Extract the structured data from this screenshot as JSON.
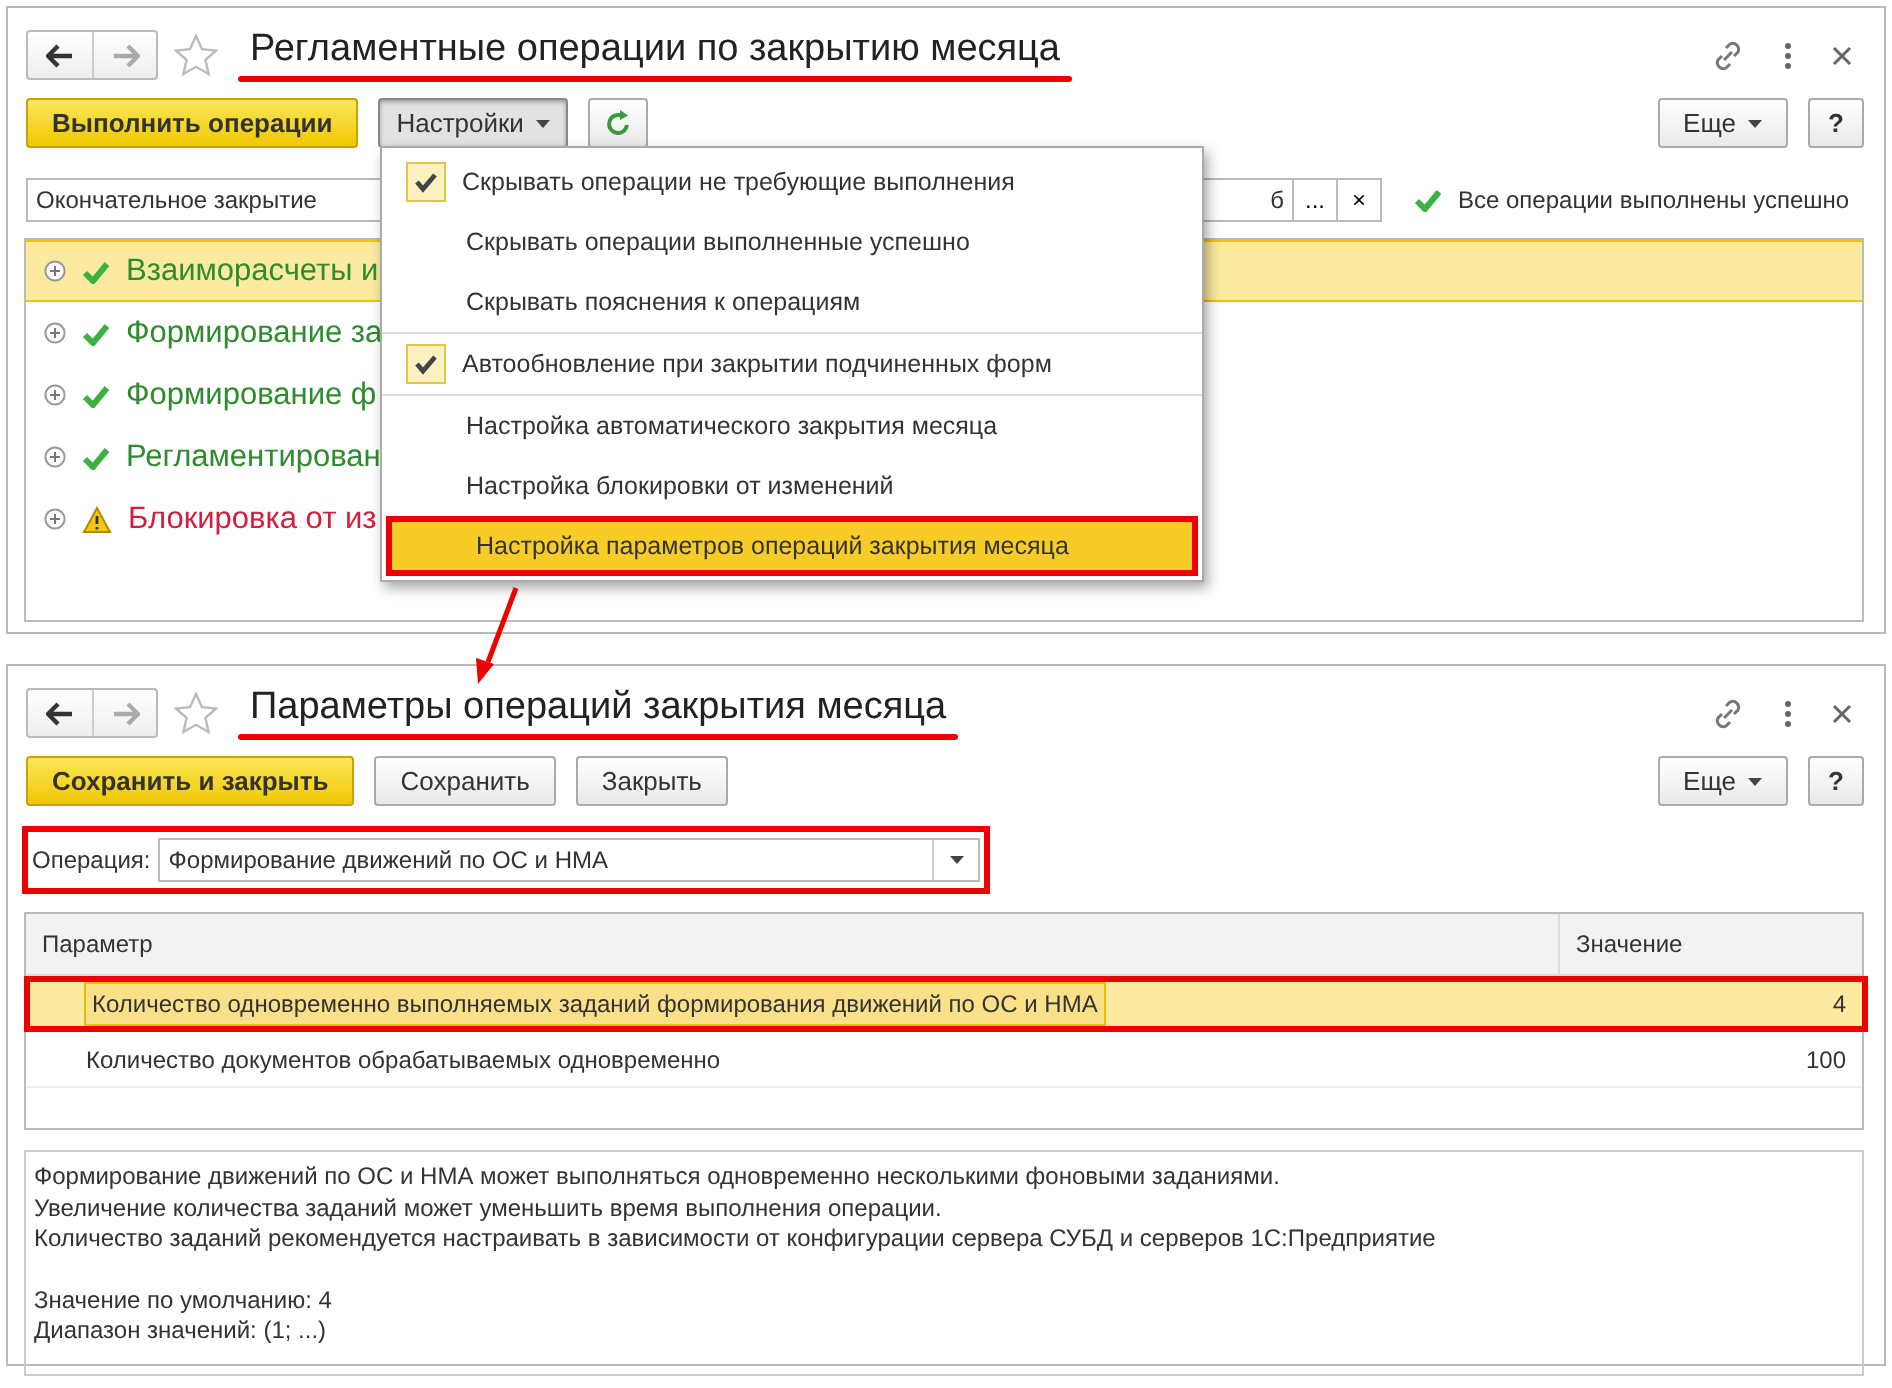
{
  "main_window": {
    "title": "Регламентные операции по закрытию месяца",
    "title_underlined": true,
    "toolbar": {
      "run_button": "Выполнить операции",
      "settings_button": "Настройки",
      "settings_open": true,
      "more_button": "Еще",
      "help_button": "?"
    },
    "filter": {
      "closing_type": "Окончательное закрытие",
      "field_2": "б",
      "select_button": "...",
      "clear_button": "×",
      "status": "Все операции выполнены успешно"
    },
    "operations": [
      {
        "label": "Взаиморасчеты и",
        "kind": "done",
        "selected": true
      },
      {
        "label": "Формирование за",
        "kind": "done",
        "selected": false
      },
      {
        "label": "Формирование ф",
        "kind": "done",
        "selected": false
      },
      {
        "label": "Регламентирован",
        "kind": "done",
        "selected": false
      },
      {
        "label": "Блокировка от из",
        "kind": "warning",
        "selected": false
      }
    ],
    "settings_menu": {
      "groups": [
        [
          {
            "label": "Скрывать операции не требующие выполнения",
            "checked": true,
            "selected": false,
            "highlighted": false
          },
          {
            "label": "Скрывать операции выполненные успешно",
            "checked": false,
            "selected": false,
            "highlighted": false
          },
          {
            "label": "Скрывать пояснения к операциям",
            "checked": false,
            "selected": false,
            "highlighted": false
          }
        ],
        [
          {
            "label": "Автообновление при закрытии подчиненных форм",
            "checked": true,
            "selected": false,
            "highlighted": false
          }
        ],
        [
          {
            "label": "Настройка автоматического закрытия месяца",
            "checked": false,
            "selected": false,
            "highlighted": false
          },
          {
            "label": "Настройка блокировки от изменений",
            "checked": false,
            "selected": false,
            "highlighted": false
          },
          {
            "label": "Настройка параметров операций закрытия месяца",
            "checked": false,
            "selected": true,
            "highlighted": true
          }
        ]
      ]
    }
  },
  "annotation_arrow": true,
  "params_window": {
    "title": "Параметры операций закрытия месяца",
    "title_underlined": true,
    "toolbar": {
      "save_close_button": "Сохранить и закрыть",
      "save_button": "Сохранить",
      "close_button": "Закрыть",
      "more_button": "Еще",
      "help_button": "?"
    },
    "operation": {
      "label": "Операция:",
      "value": "Формирование движений по ОС и НМА",
      "highlighted": true
    },
    "table": {
      "columns": [
        "Параметр",
        "Значение"
      ],
      "rows": [
        {
          "parameter": "Количество одновременно выполняемых заданий формирования движений по ОС и НМА",
          "value": "4",
          "selected": true,
          "highlighted": true
        },
        {
          "parameter": "Количество документов обрабатываемых одновременно",
          "value": "100",
          "selected": false,
          "highlighted": false
        }
      ]
    },
    "description": {
      "paragraphs": [
        {
          "lines": [
            "Формирование движений по ОС и НМА может выполняться одновременно несколькими фоновыми заданиями.",
            "Увеличение количества заданий может уменьшить время выполнения операции.",
            "Количество заданий рекомендуется настраивать в зависимости от конфигурации сервера СУБД и серверов 1С:Предприятие"
          ]
        },
        {
          "lines": [
            "Значение по умолчанию: 4",
            "Диапазон значений: (1; ...)"
          ]
        }
      ]
    }
  }
}
